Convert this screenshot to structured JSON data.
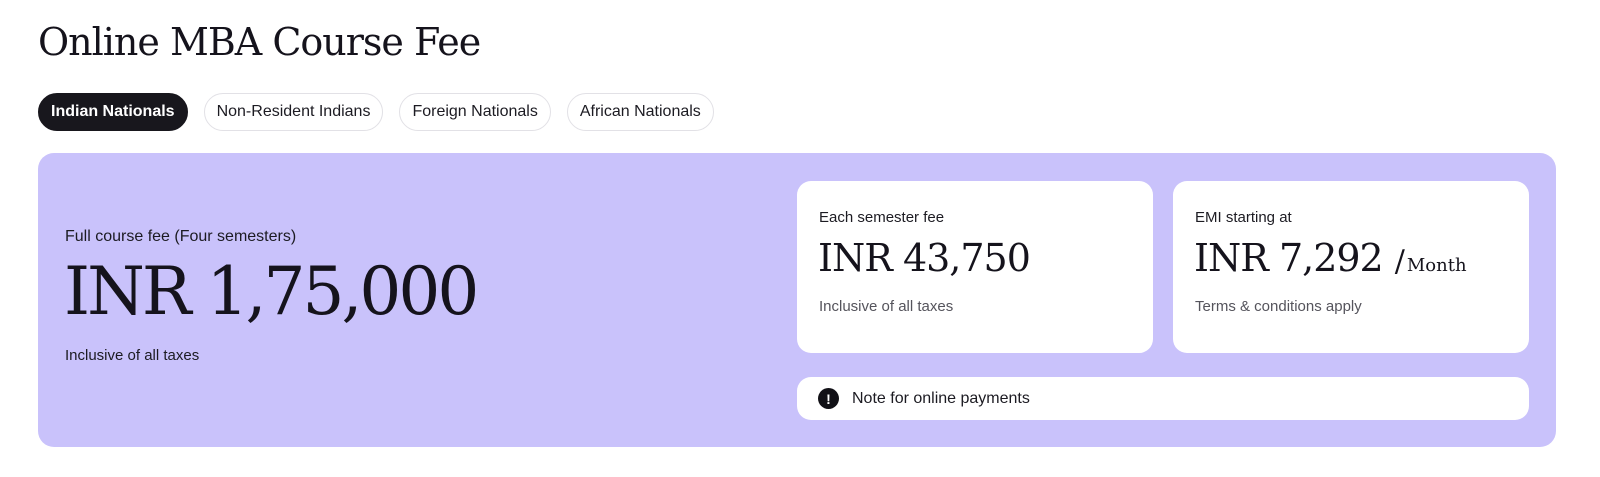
{
  "page_title": "Online MBA Course Fee",
  "tabs": [
    {
      "label": "Indian Nationals",
      "active": true
    },
    {
      "label": "Non-Resident Indians",
      "active": false
    },
    {
      "label": "Foreign Nationals",
      "active": false
    },
    {
      "label": "African Nationals",
      "active": false
    }
  ],
  "full_fee": {
    "label": "Full course fee (Four semesters)",
    "amount": "INR 1,75,000",
    "note": "Inclusive of all taxes"
  },
  "semester_fee": {
    "label": "Each semester fee",
    "amount": "INR 43,750",
    "note": "Inclusive of all taxes"
  },
  "emi": {
    "label": "EMI starting at",
    "amount": "INR 7,292",
    "slash": "/",
    "unit": "Month",
    "note": "Terms & conditions apply"
  },
  "payment_note": {
    "icon": "exclamation-circle-icon",
    "icon_glyph": "!",
    "text": "Note for online payments"
  },
  "colors": {
    "panel_background": "#c9c2fb",
    "active_tab": "#18171d"
  }
}
